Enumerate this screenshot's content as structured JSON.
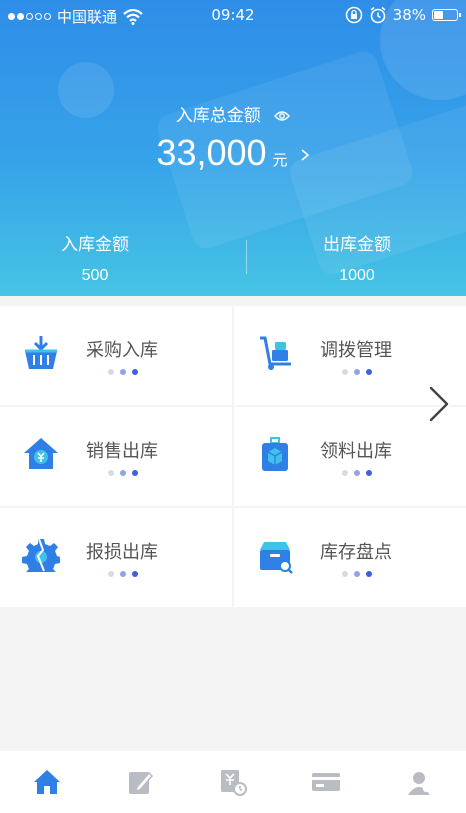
{
  "status_bar": {
    "carrier": "中国联通",
    "time": "09:42",
    "battery": "38%"
  },
  "summary": {
    "total_label": "入库总金额",
    "total_amount": "33,000",
    "total_unit": "元",
    "in_label": "入库金额",
    "in_value": "500",
    "out_label": "出库金额",
    "out_value": "1000"
  },
  "menu": [
    {
      "label": "采购入库",
      "icon": "basket-download-icon"
    },
    {
      "label": "调拨管理",
      "icon": "hand-truck-icon"
    },
    {
      "label": "销售出库",
      "icon": "house-yuan-icon"
    },
    {
      "label": "领料出库",
      "icon": "package-bag-icon"
    },
    {
      "label": "报损出库",
      "icon": "broken-gear-icon"
    },
    {
      "label": "库存盘点",
      "icon": "box-search-icon"
    }
  ],
  "tabbar": [
    {
      "icon": "home-icon",
      "active": true
    },
    {
      "icon": "edit-icon",
      "active": false
    },
    {
      "icon": "bill-clock-icon",
      "active": false
    },
    {
      "icon": "card-icon",
      "active": false
    },
    {
      "icon": "profile-icon",
      "active": false
    }
  ],
  "colors": {
    "primary": "#2f8de8",
    "accent_blue": "#2f7fe6",
    "inactive_icon": "#b9bcc2"
  }
}
